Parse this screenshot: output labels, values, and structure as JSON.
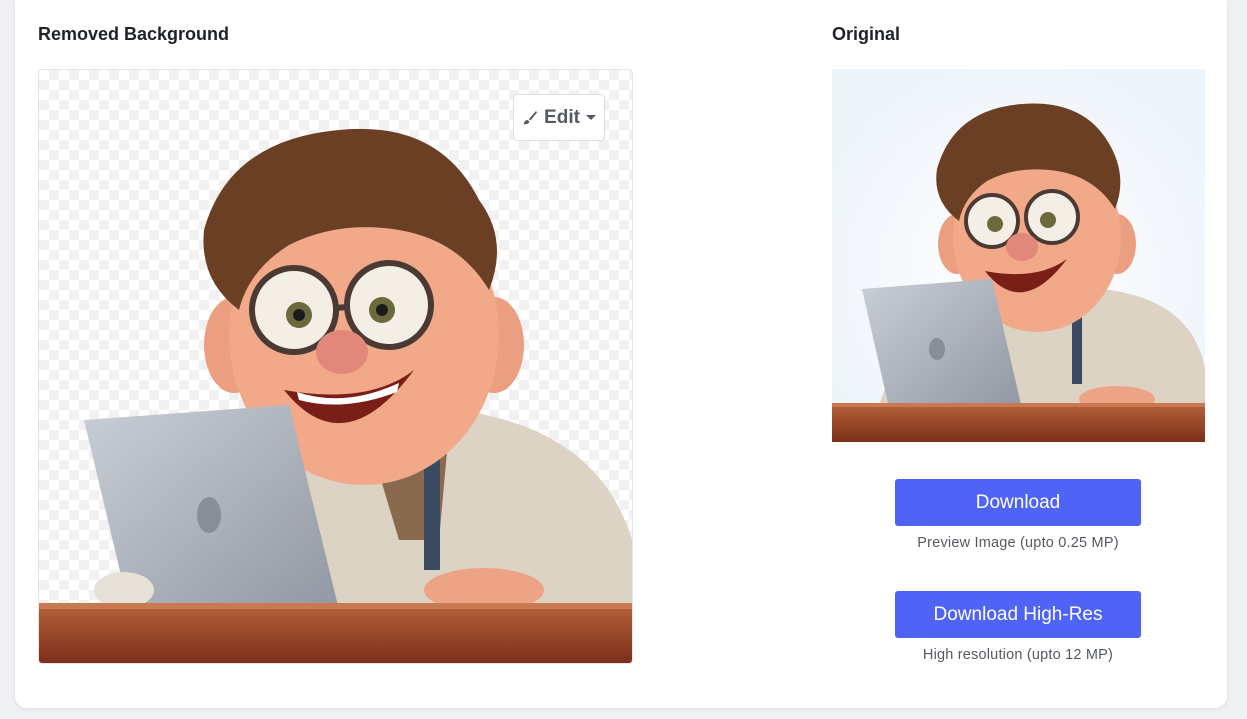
{
  "result_panel": {
    "title": "Removed Background",
    "edit_label": "Edit",
    "image_subject": "cartoon man with glasses at laptop (background removed)"
  },
  "original_panel": {
    "title": "Original",
    "image_subject": "cartoon man with glasses at laptop"
  },
  "downloads": {
    "preview": {
      "label": "Download",
      "caption": "Preview Image (upto 0.25 MP)"
    },
    "high_res": {
      "label": "Download High-Res",
      "caption": "High resolution (upto 12 MP)"
    }
  },
  "colors": {
    "accent": "#4f63f7",
    "text": "#1f2328",
    "muted": "#555a60",
    "card": "#ffffff",
    "page": "#eef0f3"
  },
  "icons": [
    "brush-icon",
    "caret-down-icon"
  ]
}
